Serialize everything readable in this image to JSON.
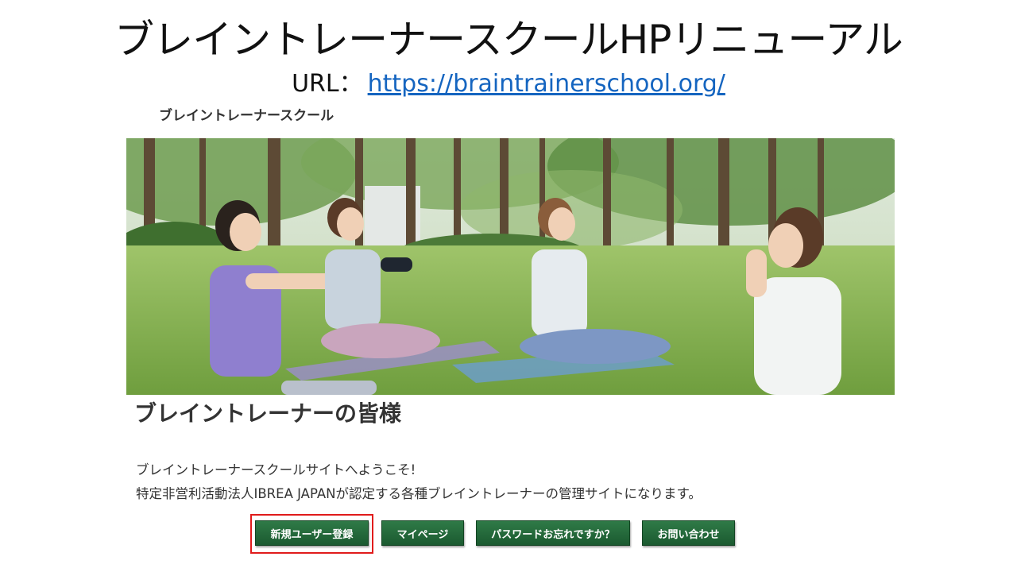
{
  "slide": {
    "title": "ブレイントレーナースクールHPリニューアル",
    "url_label": "URL：",
    "url": "https://braintrainerschool.org/"
  },
  "site": {
    "logo_text": "ブレイントレーナースクール",
    "hero_image": "people-stretching-in-park-photo",
    "heading": "ブレイントレーナーの皆様",
    "welcome_lines": [
      "ブレイントレーナースクールサイトへようこそ!",
      "特定非営利活動法人IBREA JAPANが認定する各種ブレイントレーナーの管理サイトになります。"
    ],
    "buttons": [
      {
        "label": "新規ユーザー登録",
        "highlighted": true
      },
      {
        "label": "マイページ",
        "highlighted": false
      },
      {
        "label": "パスワードお忘れですか？",
        "highlighted": false
      },
      {
        "label": "お問い合わせ",
        "highlighted": false
      }
    ]
  },
  "colors": {
    "button_bg": "#1f6336",
    "highlight_border": "#e01b1b",
    "link": "#1565c0"
  }
}
